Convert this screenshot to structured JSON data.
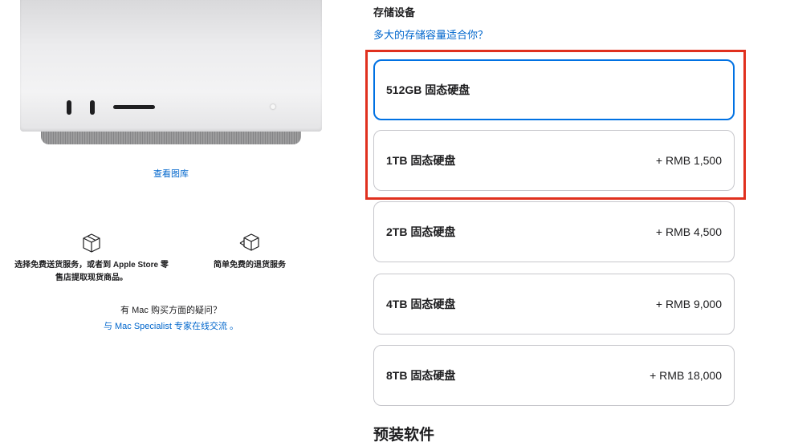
{
  "left": {
    "gallery_link": "查看图库",
    "services": [
      {
        "icon": "box-icon",
        "text": "选择免费送货服务，或者到 Apple Store 零售店提取现货商品。"
      },
      {
        "icon": "box-return-icon",
        "text": "简单免费的退货服务"
      }
    ],
    "help": {
      "question": "有 Mac 购买方面的疑问？",
      "link": "与 Mac Specialist 专家在线交流 。"
    }
  },
  "storage": {
    "title": "存储设备",
    "help_link": "多大的存储容量适合你？",
    "options": [
      {
        "label": "512GB 固态硬盘",
        "price": "",
        "selected": true
      },
      {
        "label": "1TB 固态硬盘",
        "price": "+ RMB 1,500",
        "selected": false
      },
      {
        "label": "2TB 固态硬盘",
        "price": "+ RMB 4,500",
        "selected": false
      },
      {
        "label": "4TB 固态硬盘",
        "price": "+ RMB 9,000",
        "selected": false
      },
      {
        "label": "8TB 固态硬盘",
        "price": "+ RMB 18,000",
        "selected": false
      }
    ]
  },
  "next_section": {
    "title": "预装软件"
  },
  "colors": {
    "accent": "#0071e3",
    "link": "#0066cc",
    "highlight": "#e0301e",
    "border": "#c7c7cc"
  }
}
